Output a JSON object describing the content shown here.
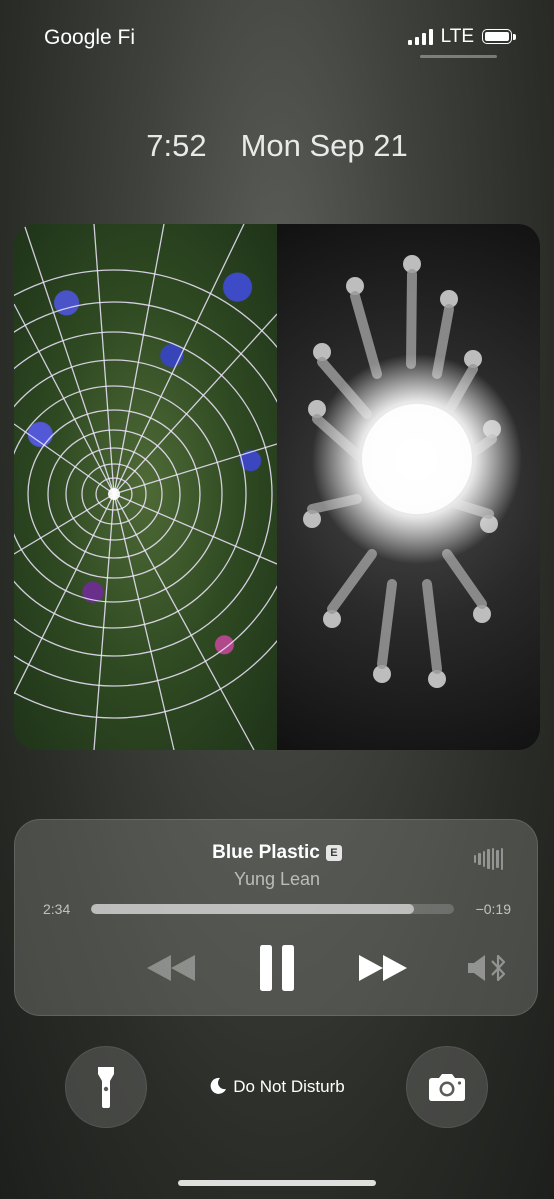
{
  "status_bar": {
    "carrier": "Google Fi",
    "network": "LTE",
    "icons": [
      "signal-icon",
      "battery-icon"
    ]
  },
  "lock_screen": {
    "time": "7:52",
    "date": "Mon Sep 21"
  },
  "now_playing": {
    "title": "Blue Plastic",
    "explicit_badge": "E",
    "artist": "Yung Lean",
    "elapsed": "2:34",
    "remaining": "−0:19",
    "progress": 0.89,
    "icons": [
      "rewind-icon",
      "pause-icon",
      "fast-forward-icon",
      "speaker-bluetooth-icon",
      "audio-waveform-icon"
    ]
  },
  "quick_actions": {
    "focus_label": "Do Not Disturb",
    "icons": [
      "flashlight-icon",
      "moon-icon",
      "camera-icon"
    ]
  },
  "colors": {
    "background": "#3f423d",
    "panel": "#787a76"
  }
}
